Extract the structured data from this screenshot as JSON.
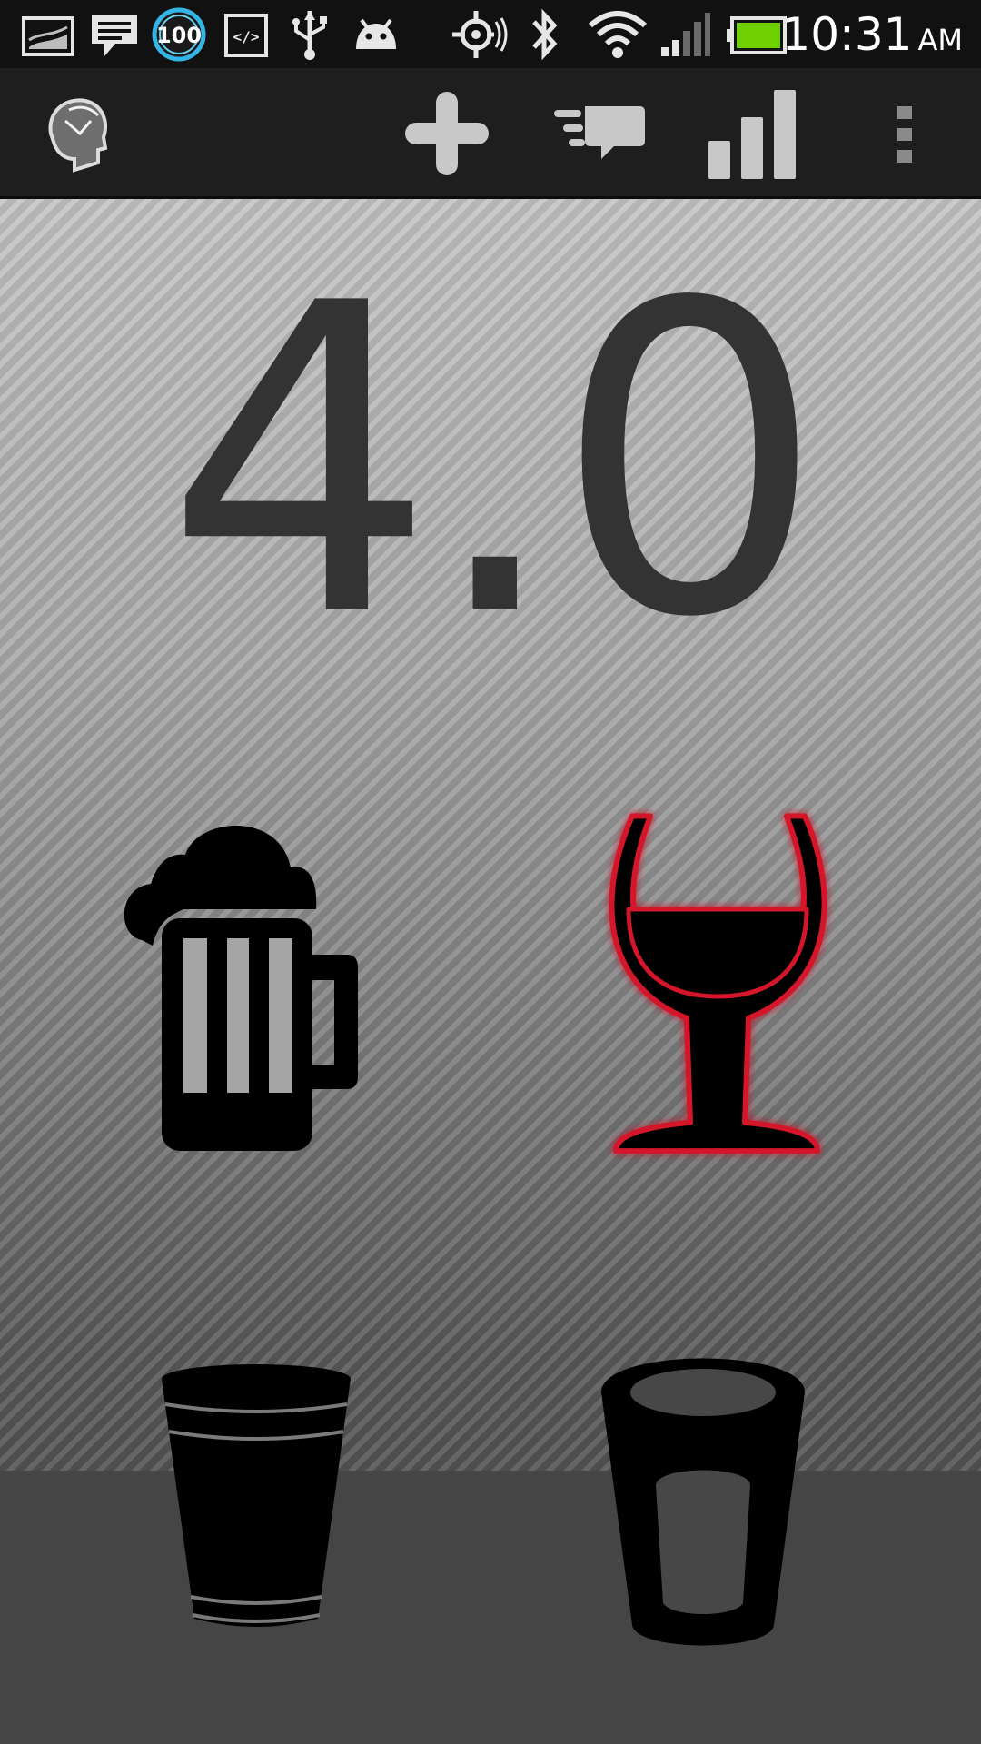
{
  "status_bar": {
    "time": "10:31",
    "ampm": "AM",
    "notification_badge": "100",
    "icons": [
      "gallery-icon",
      "message-icon",
      "notification-badge-icon",
      "code-icon",
      "usb-icon",
      "android-icon",
      "gps-icon",
      "bluetooth-icon",
      "wifi-icon",
      "cell-signal-icon",
      "battery-icon"
    ],
    "battery_color": "#6fd000"
  },
  "action_bar": {
    "app_icon": "head-profile-icon",
    "actions": [
      "add-icon",
      "feedback-icon",
      "stats-icon",
      "overflow-menu-icon"
    ]
  },
  "main": {
    "value": "4.0",
    "drinks": [
      "beer-mug-icon",
      "wine-glass-icon",
      "cup-icon",
      "glass-icon"
    ],
    "selected_drink": "wine-glass-icon",
    "highlight_color": "#d3122b"
  }
}
